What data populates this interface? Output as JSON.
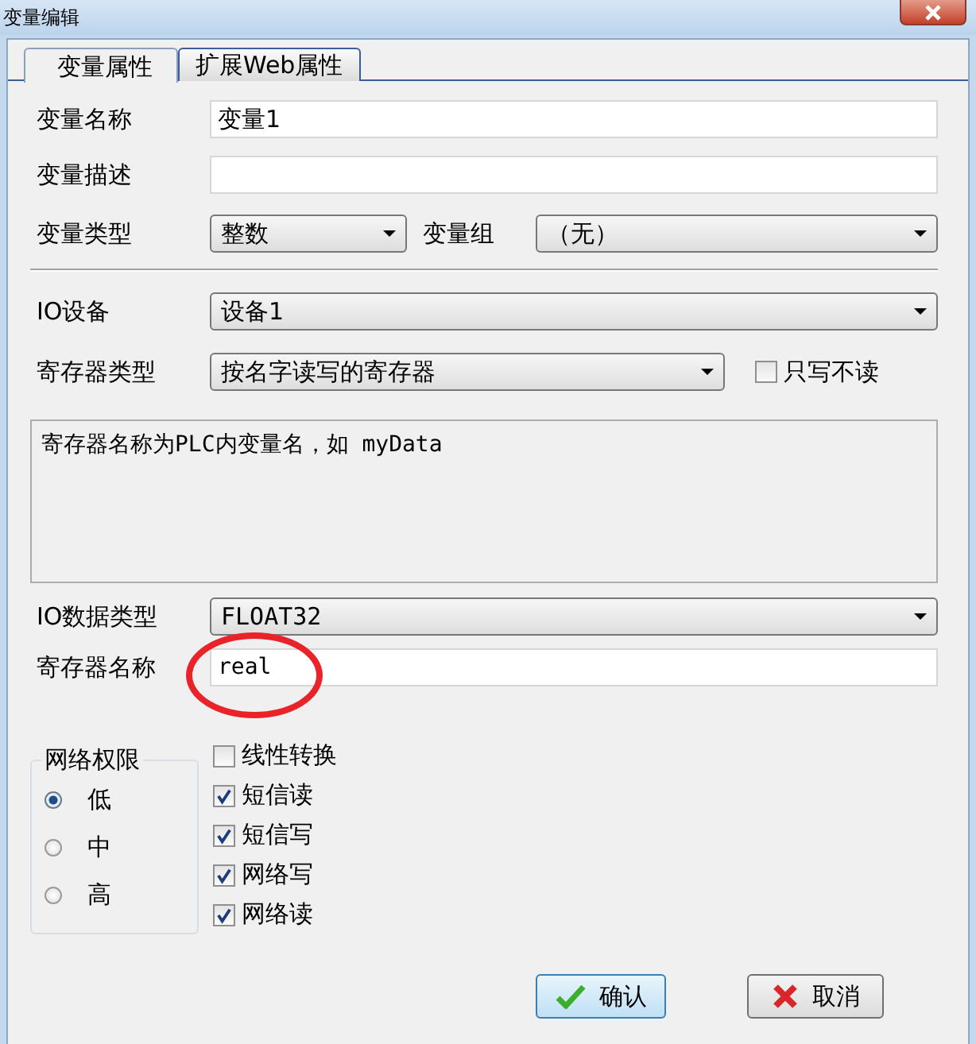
{
  "window": {
    "title": "变量编辑"
  },
  "tabs": [
    {
      "label": "变量属性",
      "selected": true
    },
    {
      "label": "扩展Web属性",
      "selected": false
    }
  ],
  "variable_name": {
    "label": "变量名称",
    "value": "变量1"
  },
  "variable_description": {
    "label": "变量描述"
  },
  "variable_type": {
    "label": "变量类型",
    "value": "整数"
  },
  "variable_group": {
    "label": "变量组",
    "value": "（无）"
  },
  "io_device": {
    "label": "IO设备",
    "value": "设备1"
  },
  "register_type": {
    "label": "寄存器类型",
    "value": "按名字读写的寄存器"
  },
  "write_only": {
    "label": "只写不读",
    "checked": false
  },
  "hint": "寄存器名称为PLC内变量名，如 myData",
  "io_data_type": {
    "label": "IO数据类型",
    "value": "FLOAT32"
  },
  "register_name": {
    "label": "寄存器名称",
    "value": "real"
  },
  "network_permission": {
    "title": "网络权限",
    "options": [
      {
        "label": "低",
        "selected": true
      },
      {
        "label": "中",
        "selected": false
      },
      {
        "label": "高",
        "selected": false
      }
    ]
  },
  "options": [
    {
      "label": "线性转换",
      "checked": false
    },
    {
      "label": "短信读",
      "checked": true
    },
    {
      "label": "短信写",
      "checked": true
    },
    {
      "label": "网络写",
      "checked": true
    },
    {
      "label": "网络读",
      "checked": true
    }
  ],
  "buttons": [
    {
      "label": "确认",
      "kind": "ok"
    },
    {
      "label": "取消",
      "kind": "cancel"
    }
  ]
}
